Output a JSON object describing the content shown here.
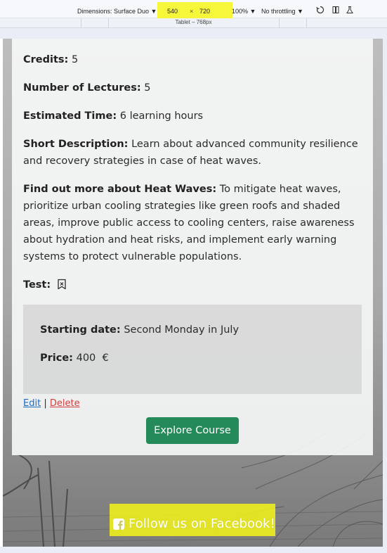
{
  "devtools": {
    "device_label": "Dimensions: Surface Duo ▼",
    "width": "540",
    "times": "×",
    "height": "720",
    "zoom": "100% ▼",
    "throttling": "No throttling ▼",
    "breakpoint_label": "Tablet – 768px",
    "icons": [
      "rotate-icon",
      "dual-screen-icon",
      "sensors-icon"
    ]
  },
  "course": {
    "credits_label": "Credits:",
    "credits_value": "5",
    "lectures_label": "Number of Lectures:",
    "lectures_value": "5",
    "time_label": "Estimated Time:",
    "time_value": "6 learning hours",
    "short_desc_label": "Short Description:",
    "short_desc_line1": "Learn about advanced community resilience",
    "short_desc_line2": "and recovery strategies in case of heat waves.",
    "more_label": "Find out more about Heat Waves:",
    "more_line1": "To mitigate heat waves,",
    "more_line2": "prioritize urban cooling strategies like green roofs and shaded",
    "more_line3": "areas, improve public access to cooling centers, raise awareness",
    "more_line4": "about hydration and heat risks, and implement early warning",
    "more_line5": "systems to protect vulnerable populations.",
    "test_label": "Test:",
    "test_icon": "bookmark-x-icon"
  },
  "schedule": {
    "start_label": "Starting date:",
    "start_value": "Second Monday in July",
    "price_label": "Price:",
    "price_value": "400  €"
  },
  "actions": {
    "edit": "Edit",
    "separator": "|",
    "delete": "Delete",
    "explore": "Explore Course"
  },
  "footer": {
    "facebook_text": "Follow us on Facebook!",
    "icon": "facebook-square-icon"
  },
  "colors": {
    "primary_button": "#248a59",
    "edit_link": "#1a6cc4",
    "delete_link": "#d33e3e",
    "highlight": "#f6f63a"
  }
}
